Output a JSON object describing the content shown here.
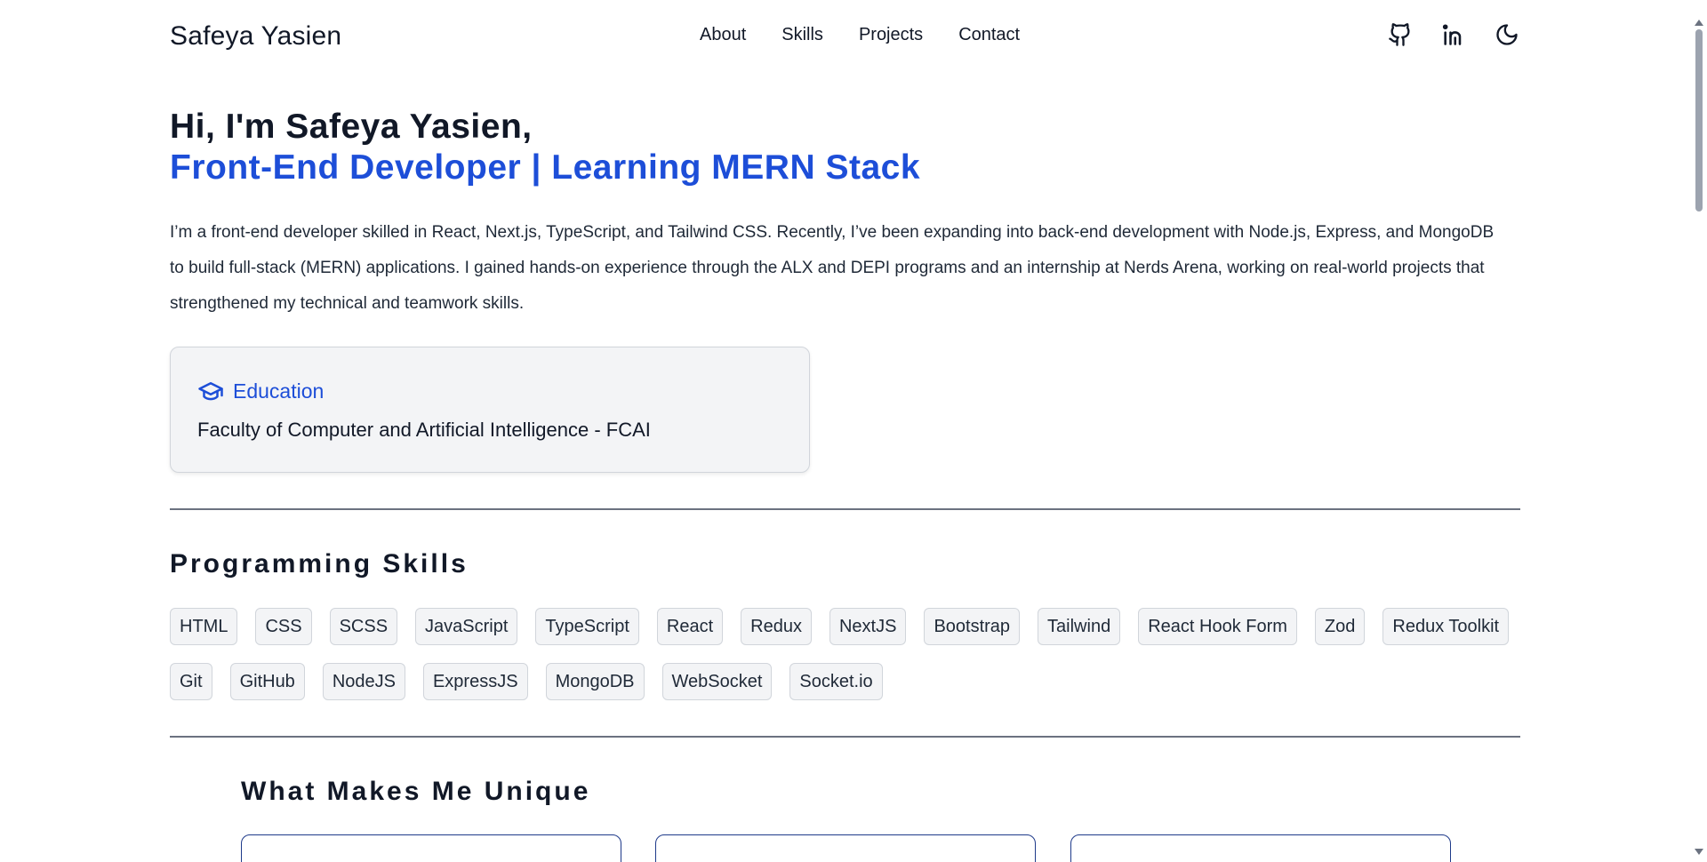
{
  "header": {
    "brand": "Safeya Yasien",
    "nav": [
      "About",
      "Skills",
      "Projects",
      "Contact"
    ],
    "icons": [
      "github-icon",
      "linkedin-icon",
      "moon-icon"
    ]
  },
  "hero": {
    "greeting": "Hi, I'm Safeya Yasien,",
    "role": "Front-End Developer | Learning MERN Stack",
    "description": "I’m a front-end developer skilled in React, Next.js, TypeScript, and Tailwind CSS. Recently, I’ve been expanding into back-end development with Node.js, Express, and MongoDB to build full-stack (MERN) applications. I gained hands-on experience through the ALX and DEPI programs and an internship at Nerds Arena, working on real-world projects that strengthened my technical and teamwork skills."
  },
  "education": {
    "title": "Education",
    "text": "Faculty of Computer and Artificial Intelligence - FCAI"
  },
  "skills_section": {
    "title": "Programming Skills",
    "items": [
      "HTML",
      "CSS",
      "SCSS",
      "JavaScript",
      "TypeScript",
      "React",
      "Redux",
      "NextJS",
      "Bootstrap",
      "Tailwind",
      "React Hook Form",
      "Zod",
      "Redux Toolkit",
      "Git",
      "GitHub",
      "NodeJS",
      "ExpressJS",
      "MongoDB",
      "WebSocket",
      "Socket.io"
    ]
  },
  "unique_section": {
    "title": "What Makes Me Unique"
  },
  "colors": {
    "accent": "#1d4ed8",
    "text": "#111827",
    "card_bg": "#f3f4f6"
  }
}
